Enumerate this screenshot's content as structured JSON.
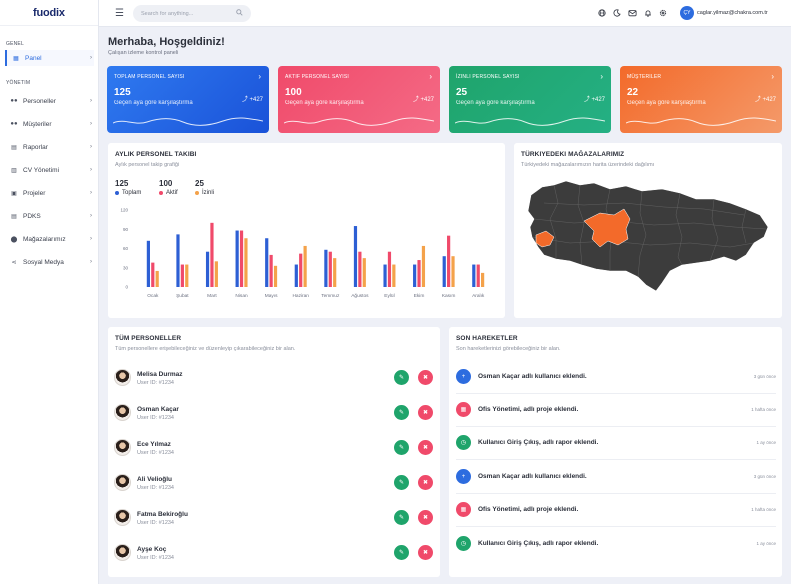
{
  "app": {
    "logo": "fuodix",
    "user_initials": "ÇY",
    "user_email": "caglar.yilmaz@chakra.com.tr"
  },
  "search": {
    "placeholder": "Search for anything..."
  },
  "sidebar": {
    "section_general": "Genel",
    "section_management": "Yönetim",
    "items": [
      {
        "label": "Panel",
        "icon": "grid-icon",
        "active": true
      },
      {
        "label": "Personeller",
        "icon": "users-icon"
      },
      {
        "label": "Müşteriler",
        "icon": "people-icon"
      },
      {
        "label": "Raporlar",
        "icon": "report-icon"
      },
      {
        "label": "CV Yönetimi",
        "icon": "document-icon"
      },
      {
        "label": "Projeler",
        "icon": "folder-icon"
      },
      {
        "label": "PDKS",
        "icon": "clipboard-icon"
      },
      {
        "label": "Mağazalarımız",
        "icon": "location-icon"
      },
      {
        "label": "Sosyal Medya",
        "icon": "share-icon"
      }
    ]
  },
  "header": {
    "title": "Merhaba, Hoşgeldiniz!",
    "subtitle": "Çalışan izleme kontrol paneli"
  },
  "stats": [
    {
      "label": "Toplam Personel Sayısı",
      "value": "125",
      "compare": "Geçen aya göre karşılaştırma",
      "delta": "+427",
      "color": "#2f7af0"
    },
    {
      "label": "Aktif Personel Sayısı",
      "value": "100",
      "compare": "Geçen aya göre karşılaştırma",
      "delta": "+427",
      "color": "#f04a6a"
    },
    {
      "label": "İzinli Personel Sayısı",
      "value": "25",
      "compare": "Geçen aya göre karşılaştırma",
      "delta": "+427",
      "color": "#1fa46b"
    },
    {
      "label": "Müşteriler",
      "value": "22",
      "compare": "Geçen aya göre karşılaştırma",
      "delta": "+427",
      "color": "#f36a2a"
    }
  ],
  "monthly": {
    "title": "Aylık Personel Takibi",
    "subtitle": "Aylık personel takip grafiği",
    "summary": [
      {
        "value": "125",
        "label": "Toplam",
        "color": "#2d5fd4"
      },
      {
        "value": "100",
        "label": "Aktif",
        "color": "#f04a6a"
      },
      {
        "value": "25",
        "label": "İzinli",
        "color": "#f4a24a"
      }
    ]
  },
  "chart_data": {
    "type": "bar",
    "categories": [
      "Ocak",
      "Şubat",
      "Mart",
      "Nisan",
      "Mayıs",
      "Haziran",
      "Temmuz",
      "Ağustos",
      "Eylül",
      "Ekim",
      "Kasım",
      "Aralık"
    ],
    "series": [
      {
        "name": "Toplam",
        "color": "#2d5fd4",
        "values": [
          72,
          82,
          55,
          88,
          76,
          35,
          58,
          95,
          35,
          35,
          48,
          35
        ]
      },
      {
        "name": "Aktif",
        "color": "#f04a6a",
        "values": [
          38,
          35,
          100,
          88,
          50,
          52,
          55,
          55,
          55,
          42,
          80,
          35
        ]
      },
      {
        "name": "İzinli",
        "color": "#f4a24a",
        "values": [
          25,
          35,
          40,
          76,
          33,
          64,
          45,
          45,
          35,
          64,
          48,
          22
        ]
      }
    ],
    "ylim": [
      0,
      120
    ],
    "yticks": [
      0,
      30,
      60,
      90,
      120
    ],
    "grid": false,
    "legend": "top-left"
  },
  "map": {
    "title": "Türkiyedeki Mağazalarımız",
    "subtitle": "Türkiyedeki mağazalarımızın harita üzerindeki dağılımı",
    "base_color": "#3c3c3c",
    "highlight_color": "#f36a2a"
  },
  "staff": {
    "title": "Tüm Personeller",
    "subtitle": "Tüm personellere erişebileceğiniz ve düzenleyip çıkarabileceğiniz bir alan.",
    "rows": [
      {
        "name": "Melisa Durmaz",
        "uid": "User ID: #1234"
      },
      {
        "name": "Osman Kaçar",
        "uid": "User ID: #1234"
      },
      {
        "name": "Ece Yılmaz",
        "uid": "User ID: #1234"
      },
      {
        "name": "Ali Velioğlu",
        "uid": "User ID: #1234"
      },
      {
        "name": "Fatma Bekiroğlu",
        "uid": "User ID: #1234"
      },
      {
        "name": "Ayşe Koç",
        "uid": "User ID: #1234"
      }
    ]
  },
  "activity": {
    "title": "Son Hareketler",
    "subtitle": "Son hareketlerinizi görebileceğiniz bir alan.",
    "rows": [
      {
        "text": "Osman Kaçar adlı kullanıcı eklendi.",
        "time": "3 gün önce",
        "icon": "user-add-icon",
        "color": "#2d6cdf"
      },
      {
        "text": "Ofis Yönetimi, adlı proje eklendi.",
        "time": "1 hafta önce",
        "icon": "calendar-icon",
        "color": "#f04a6a"
      },
      {
        "text": "Kullanıcı Giriş Çıkış, adlı rapor eklendi.",
        "time": "1 ay önce",
        "icon": "clock-icon",
        "color": "#1fa46b"
      },
      {
        "text": "Osman Kaçar adlı kullanıcı eklendi.",
        "time": "3 gün önce",
        "icon": "user-add-icon",
        "color": "#2d6cdf"
      },
      {
        "text": "Ofis Yönetimi, adlı proje eklendi.",
        "time": "1 hafta önce",
        "icon": "calendar-icon",
        "color": "#f04a6a"
      },
      {
        "text": "Kullanıcı Giriş Çıkış, adlı rapor eklendi.",
        "time": "1 ay önce",
        "icon": "clock-icon",
        "color": "#1fa46b"
      }
    ]
  }
}
